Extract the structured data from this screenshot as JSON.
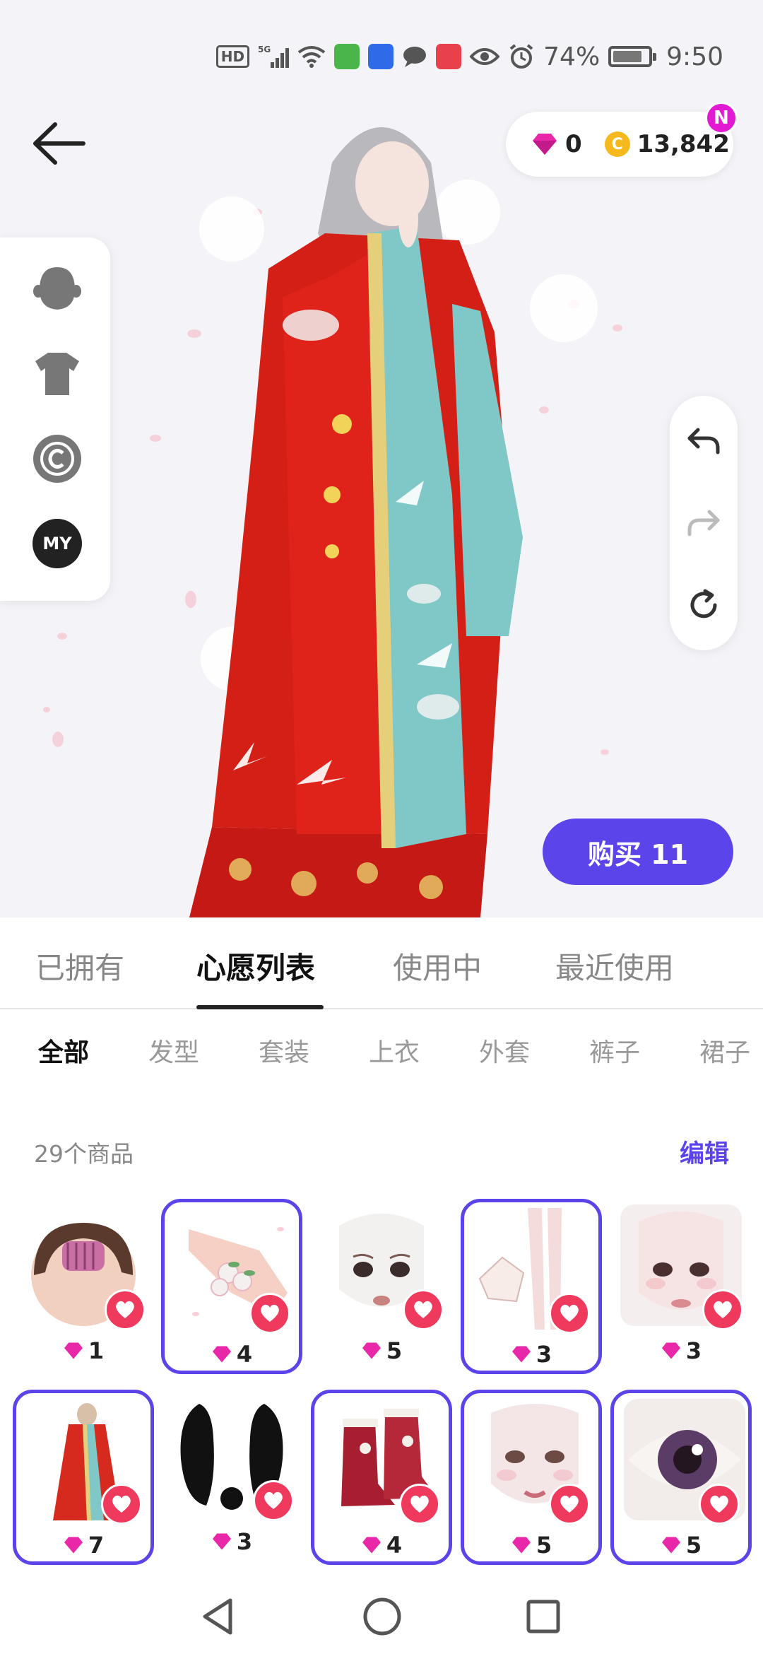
{
  "status_bar": {
    "hd": "HD",
    "network": "5G",
    "battery": "74%",
    "time": "9:50",
    "colors": {
      "app_green": "#4ab54a",
      "app_blue": "#2f6be8",
      "app_red": "#e8414c"
    }
  },
  "header": {
    "back_icon": "arrow-left-icon",
    "gems": "0",
    "coins": "13,842",
    "coin_symbol": "C",
    "notification_badge": "N"
  },
  "side_tools": {
    "items": [
      "head-icon",
      "shirt-icon",
      "copyright-icon"
    ],
    "my_label": "MY"
  },
  "right_tools": [
    "undo-icon",
    "redo-icon",
    "refresh-icon"
  ],
  "buy_button": {
    "label": "购买 11"
  },
  "tabs": [
    {
      "label": "已拥有",
      "active": false
    },
    {
      "label": "心愿列表",
      "active": true
    },
    {
      "label": "使用中",
      "active": false
    },
    {
      "label": "最近使用",
      "active": false
    }
  ],
  "categories": [
    {
      "label": "全部",
      "active": true
    },
    {
      "label": "发型",
      "active": false
    },
    {
      "label": "套装",
      "active": false
    },
    {
      "label": "上衣",
      "active": false
    },
    {
      "label": "外套",
      "active": false
    },
    {
      "label": "裤子",
      "active": false
    },
    {
      "label": "裙子",
      "active": false
    }
  ],
  "list_header": {
    "count": "29个商品",
    "edit": "编辑"
  },
  "items": [
    {
      "name": "hair-roller-item",
      "price": "1",
      "selected": false
    },
    {
      "name": "floral-hand-item",
      "price": "4",
      "selected": true
    },
    {
      "name": "face-item-1",
      "price": "5",
      "selected": false
    },
    {
      "name": "body-item",
      "price": "3",
      "selected": true
    },
    {
      "name": "face-item-2",
      "price": "3",
      "selected": false
    },
    {
      "name": "hanfu-outfit-item",
      "price": "7",
      "selected": true
    },
    {
      "name": "black-fur-item",
      "price": "3",
      "selected": false
    },
    {
      "name": "red-boots-item",
      "price": "4",
      "selected": true
    },
    {
      "name": "face-item-3",
      "price": "5",
      "selected": true
    },
    {
      "name": "eye-item",
      "price": "5",
      "selected": true
    }
  ],
  "nav_bar": [
    "back-triangle-icon",
    "home-circle-icon",
    "recents-square-icon"
  ],
  "colors": {
    "accent": "#5b45ea",
    "heart": "#f03a5d",
    "gem": "#e828a8",
    "coin": "#f6b91d"
  }
}
